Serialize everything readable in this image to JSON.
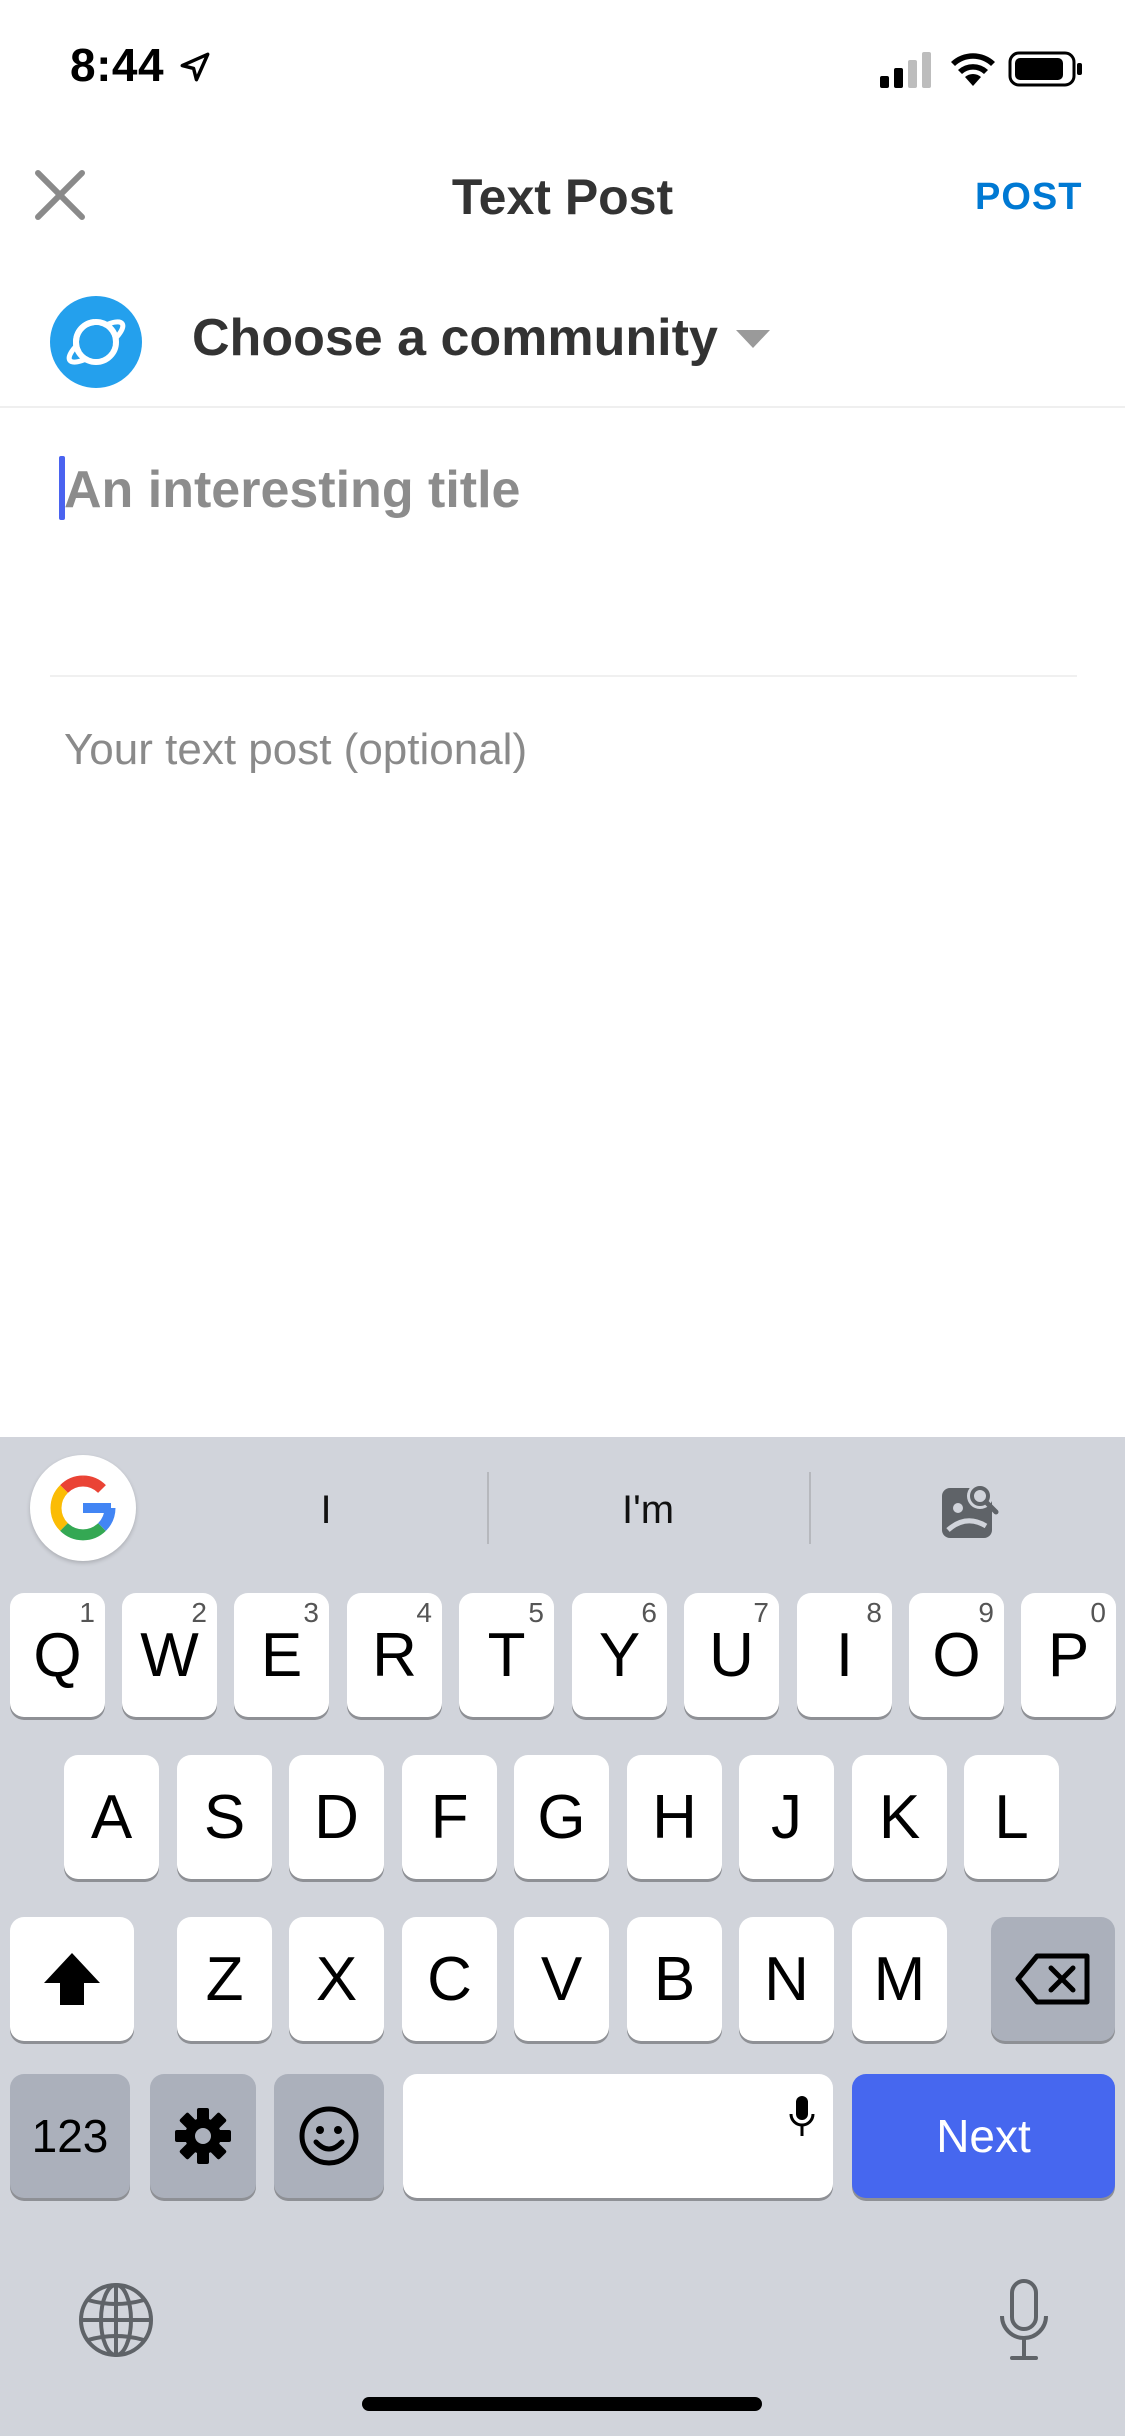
{
  "status_bar": {
    "time": "8:44"
  },
  "header": {
    "title": "Text Post",
    "post_label": "POST"
  },
  "community": {
    "label": "Choose a community"
  },
  "form": {
    "title_placeholder": "An interesting title",
    "body_placeholder": "Your text post (optional)"
  },
  "keyboard": {
    "suggestions": [
      "I",
      "I'm"
    ],
    "row1": [
      {
        "k": "Q",
        "n": "1"
      },
      {
        "k": "W",
        "n": "2"
      },
      {
        "k": "E",
        "n": "3"
      },
      {
        "k": "R",
        "n": "4"
      },
      {
        "k": "T",
        "n": "5"
      },
      {
        "k": "Y",
        "n": "6"
      },
      {
        "k": "U",
        "n": "7"
      },
      {
        "k": "I",
        "n": "8"
      },
      {
        "k": "O",
        "n": "9"
      },
      {
        "k": "P",
        "n": "0"
      }
    ],
    "row2": [
      "A",
      "S",
      "D",
      "F",
      "G",
      "H",
      "J",
      "K",
      "L"
    ],
    "row3": [
      "Z",
      "X",
      "C",
      "V",
      "B",
      "N",
      "M"
    ],
    "numbers_label": "123",
    "return_label": "Next"
  },
  "colors": {
    "accent": "#0079d3",
    "community_icon": "#24a0ed",
    "caret": "#4a63f0",
    "next_key": "#4667ef",
    "keyboard_bg": "#d1d4db"
  },
  "icons": {
    "close": "close-icon",
    "community": "planet-icon",
    "chevron": "chevron-down-icon",
    "google": "google-logo-icon",
    "lens": "google-lens-icon",
    "shift": "shift-icon",
    "backspace": "backspace-icon",
    "settings": "gear-icon",
    "emoji": "emoji-icon",
    "dictation": "microphone-icon",
    "globe": "globe-icon"
  }
}
